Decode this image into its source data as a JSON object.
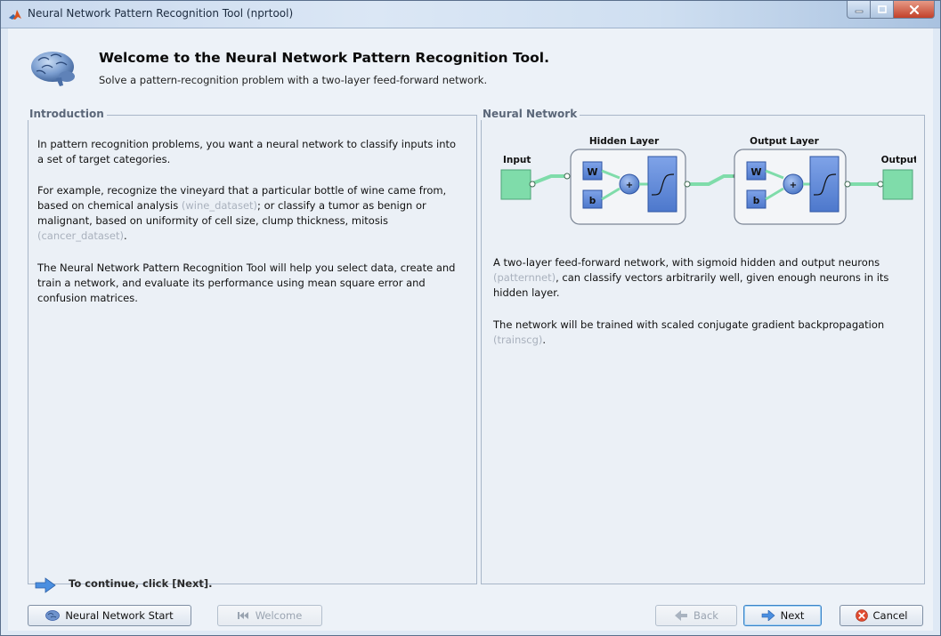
{
  "window": {
    "title": "Neural Network Pattern Recognition Tool (nprtool)"
  },
  "header": {
    "title": "Welcome to the Neural Network Pattern Recognition Tool.",
    "subtitle": "Solve a pattern-recognition problem with a two-layer feed-forward network."
  },
  "intro": {
    "title": "Introduction",
    "p1": "In pattern recognition problems, you want a neural network to classify inputs into a set of target categories.",
    "p2_part1": "For example, recognize the vineyard that a particular bottle of wine came from, based on chemical analysis ",
    "p2_code1": "(wine_dataset)",
    "p2_part2": "; or classify a tumor as benign or malignant, based on uniformity of cell size, clump thickness, mitosis ",
    "p2_code2": "(cancer_dataset)",
    "p2_part3": ".",
    "p3": "The Neural Network Pattern Recognition Tool will help you select data, create and train a network, and evaluate its performance using mean square error and confusion matrices."
  },
  "network": {
    "title": "Neural Network",
    "diagram": {
      "input_label": "Input",
      "hidden_label": "Hidden Layer",
      "output_layer_label": "Output Layer",
      "output_label": "Output",
      "weight_label": "W",
      "bias_label": "b",
      "sum_label": "+"
    },
    "p1_part1": "A two-layer feed-forward network, with sigmoid hidden and output neurons ",
    "p1_code": "(patternnet)",
    "p1_part2": ", can classify vectors arbitrarily well, given enough neurons in its hidden layer.",
    "p2_part1": "The network will be trained with scaled conjugate gradient backpropagation ",
    "p2_code": "(trainscg)",
    "p2_part2": "."
  },
  "footer": {
    "continue_text": "To continue, click [Next].",
    "nn_start_label": "Neural Network Start",
    "welcome_label": "Welcome",
    "back_label": "Back",
    "next_label": "Next",
    "cancel_label": "Cancel"
  },
  "colors": {
    "accent_blue": "#5b86d6",
    "diagram_green": "#7fdcaa",
    "code_gray": "#a9b1bd"
  }
}
